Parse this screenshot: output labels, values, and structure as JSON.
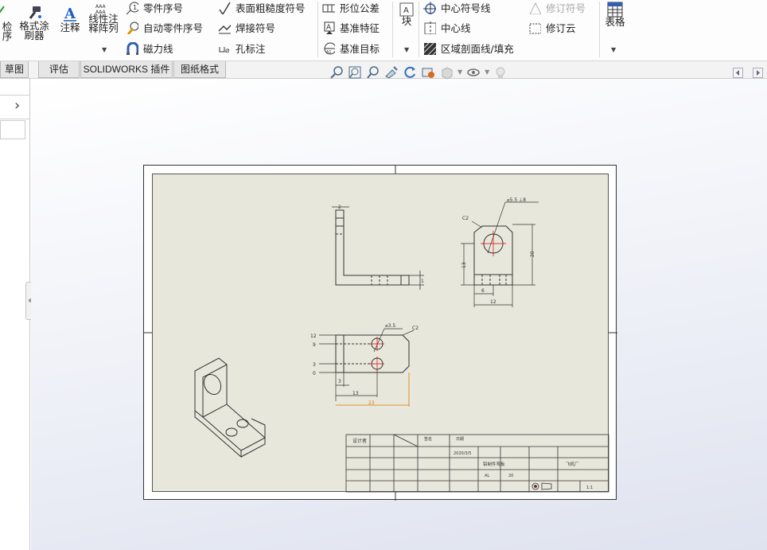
{
  "ribbon": {
    "inspect_label_1": "检",
    "inspect_label_2": "序",
    "format_painter_label_1": "格式涂",
    "format_painter_label_2": "刷器",
    "note_label": "注释",
    "linear_note_label_1": "线性注",
    "linear_note_label_2": "释阵列",
    "balloon_label": "零件序号",
    "auto_balloon_label": "自动零件序号",
    "magnetic_line_label": "磁力线",
    "surface_finish_label": "表面粗糙度符号",
    "weld_symbol_label": "焊接符号",
    "hole_callout_label": "孔标注",
    "geometric_tolerance_label": "形位公差",
    "datum_feature_label": "基准特征",
    "datum_target_label": "基准目标",
    "block_label": "块",
    "center_mark_label": "中心符号线",
    "centerline_label": "中心线",
    "area_hatch_label": "区域剖面线/填充",
    "revision_symbol_label": "修订符号",
    "revision_cloud_label": "修订云",
    "table_label": "表格"
  },
  "tabs": [
    {
      "label": "草图"
    },
    {
      "label": "评估"
    },
    {
      "label": "SOLIDWORKS 插件"
    },
    {
      "label": "图纸格式"
    }
  ],
  "left_panel": {
    "expand_arrow": "›"
  },
  "drawing": {
    "top_view_dims": {
      "hole_callout": "⌀5.5 ⊥8",
      "chamfer": "C2",
      "height_20": "20",
      "height_13": "13",
      "width_6": "6",
      "width_12": "12"
    },
    "front_view_dims": {
      "hole_callout": "⌀3.5",
      "chamfer": "C2",
      "y_12": "12",
      "y_9": "9",
      "y_3": "3",
      "y_0": "0",
      "x_3": "3",
      "x_13": "13",
      "x_23": "23"
    },
    "title_block": {
      "header_1": "设计者",
      "header_2": "签名",
      "header_3": "日期",
      "date": "2020/3/5",
      "unit_name": "飞机厂",
      "part_title": "铝制件弯板",
      "scale": "1:1",
      "material": "AL",
      "weight": "20"
    }
  },
  "colors": {
    "sheet_bg": "#e8e7dc",
    "dim_orange": "#e07800",
    "center_red": "#e00000"
  }
}
